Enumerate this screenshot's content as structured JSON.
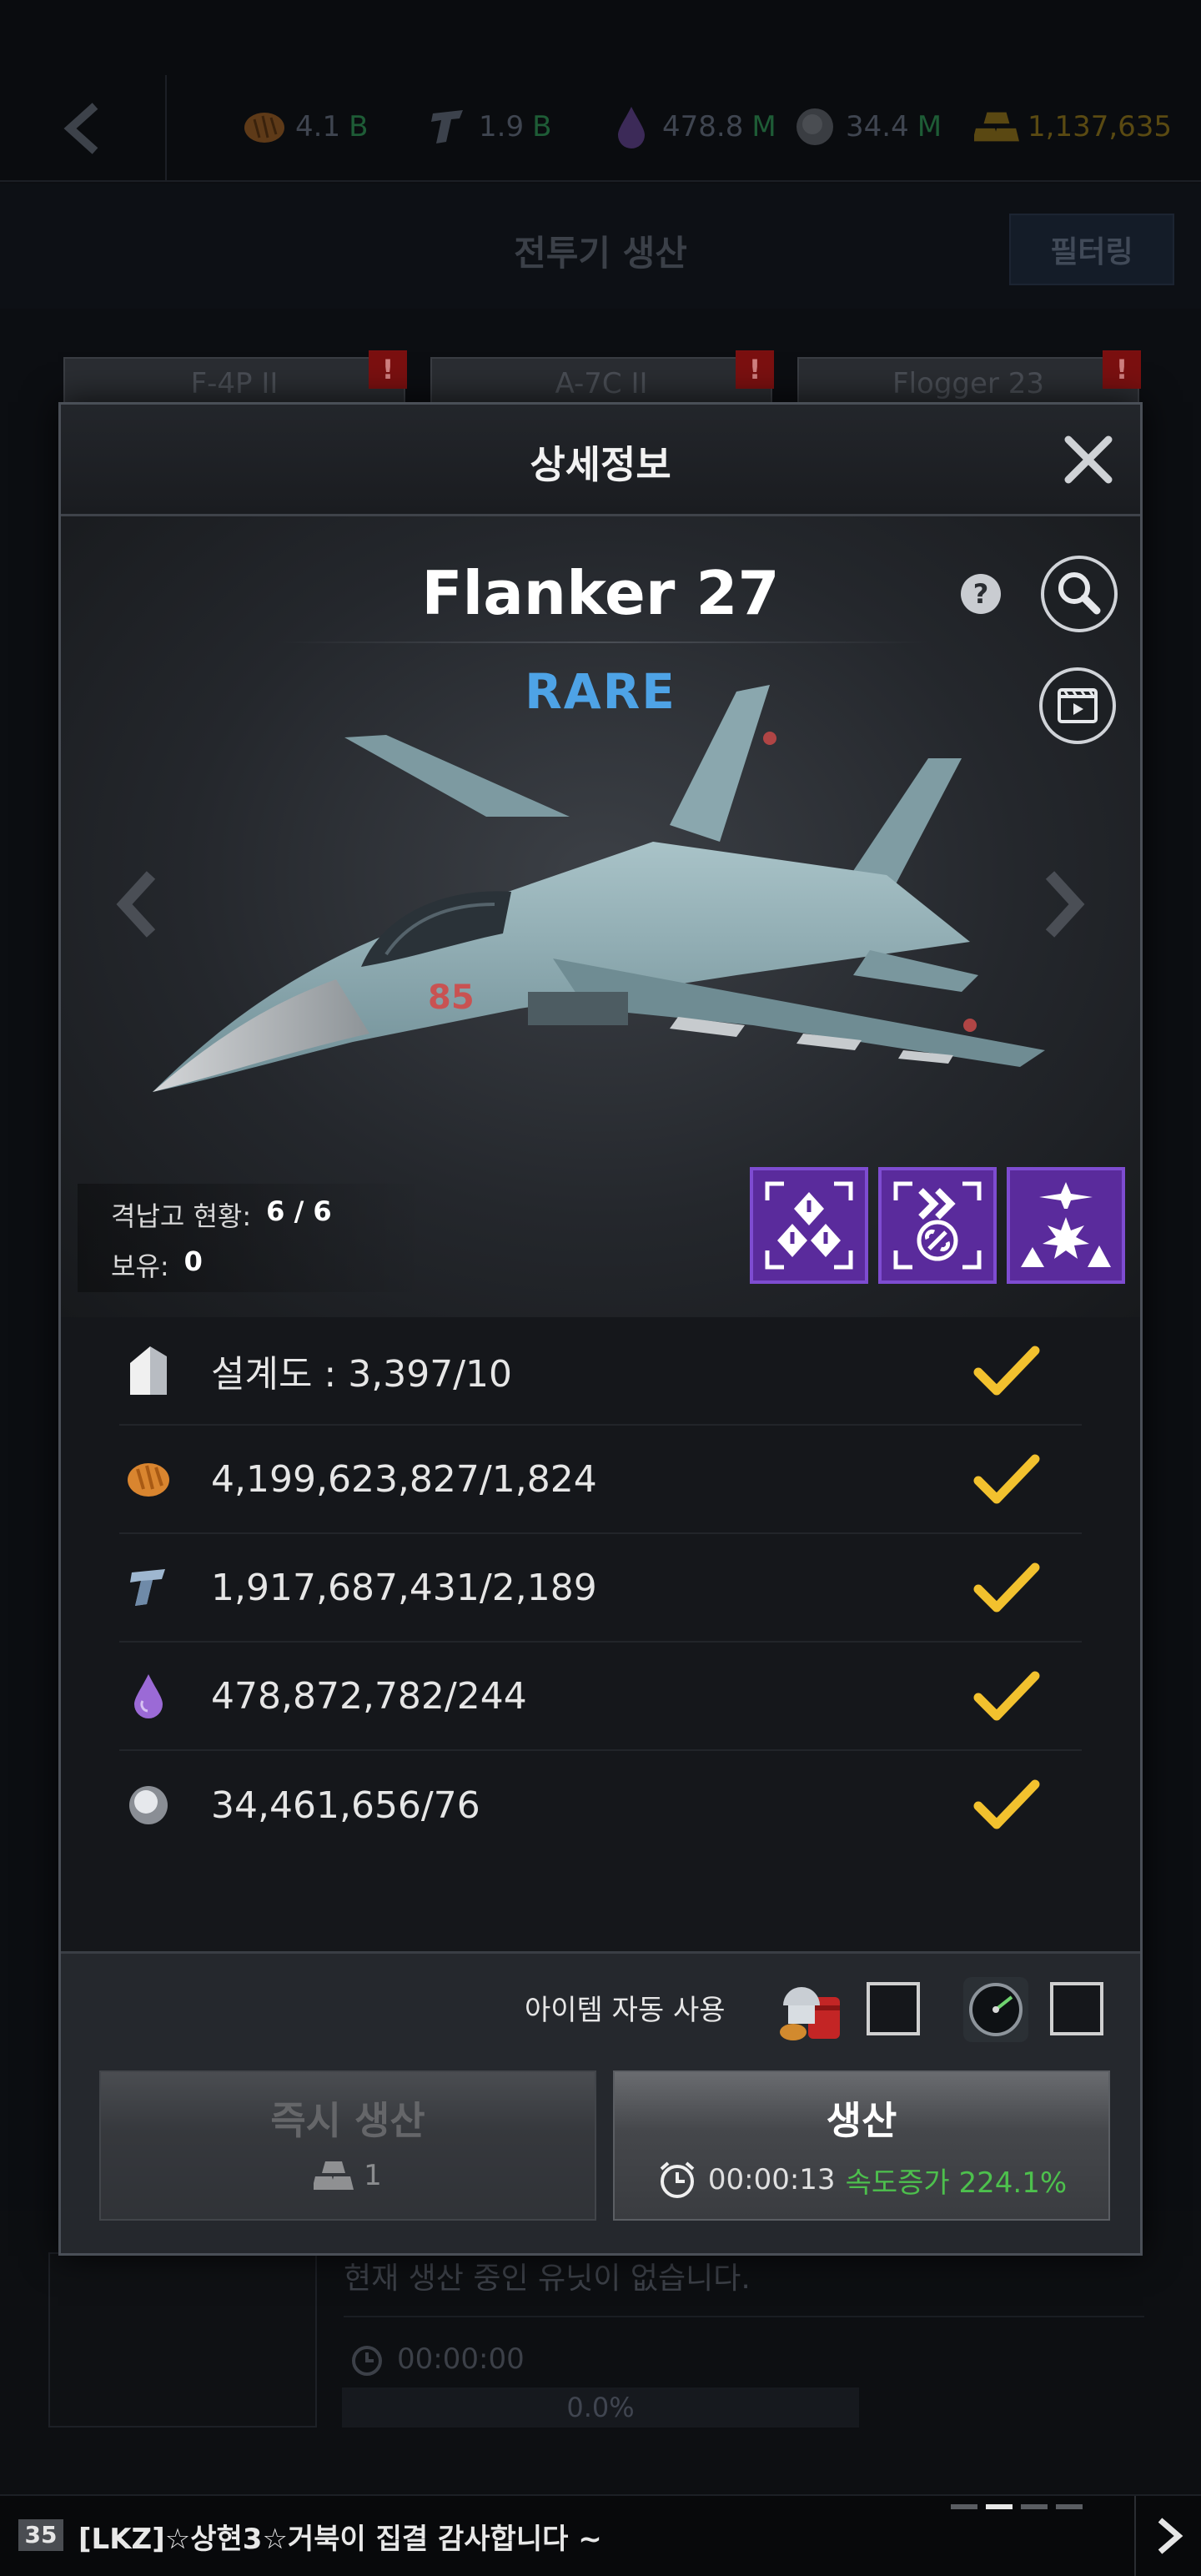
{
  "header": {
    "resources": [
      {
        "name": "food",
        "icon": "bread-icon",
        "value": "4.1",
        "unit": "B"
      },
      {
        "name": "steel",
        "icon": "steel-beam-icon",
        "value": "1.9",
        "unit": "B"
      },
      {
        "name": "oil",
        "icon": "oil-drop-icon",
        "value": "478.8",
        "unit": "M"
      },
      {
        "name": "rare-earth",
        "icon": "mineral-orb-icon",
        "value": "34.4",
        "unit": "M"
      },
      {
        "name": "gold",
        "icon": "gold-bars-icon",
        "value": "1,137,635",
        "unit": ""
      }
    ],
    "title": "전투기 생산",
    "filter_label": "필터링"
  },
  "tabs": [
    {
      "label": "F-4P II",
      "alert": "!"
    },
    {
      "label": "A-7C II",
      "alert": "!"
    },
    {
      "label": "Flogger 23",
      "alert": "!"
    }
  ],
  "queue": {
    "empty_text": "현재 생산 중인 유닛이 없습니다.",
    "timer": "00:00:00",
    "progress": "0.0%"
  },
  "chat": {
    "level": "35",
    "message": "[LKZ]☆상현3☆거북이  집결 감사합니다 ~"
  },
  "modal": {
    "title": "상세정보",
    "unit_name": "Flanker 27",
    "rarity": "RARE",
    "stats": {
      "hangar_label": "격납고 현황:",
      "hangar_value": "6 / 6",
      "owned_label": "보유:",
      "owned_value": "0"
    },
    "skills": [
      "alert-target-icon",
      "speed-link-icon",
      "air-strike-icon"
    ],
    "requirements": [
      {
        "icon": "blueprint-icon",
        "text": "설계도 : 3,397/10",
        "met": true
      },
      {
        "icon": "bread-icon",
        "text": "4,199,623,827/1,824",
        "met": true
      },
      {
        "icon": "steel-beam-icon",
        "text": "1,917,687,431/2,189",
        "met": true
      },
      {
        "icon": "oil-drop-icon",
        "text": "478,872,782/244",
        "met": true
      },
      {
        "icon": "mineral-orb-icon",
        "text": "34,461,656/76",
        "met": true
      }
    ],
    "auto_use_label": "아이템 자동 사용",
    "instant": {
      "label": "즉시 생산",
      "cost": "1"
    },
    "produce": {
      "label": "생산",
      "time": "00:00:13",
      "boost": "속도증가 224.1%"
    }
  },
  "colors": {
    "rarity": "#4ea3e6",
    "check": "#f2c12e",
    "skill_bg": "#5a2b9c",
    "boost": "#4dc04d"
  }
}
